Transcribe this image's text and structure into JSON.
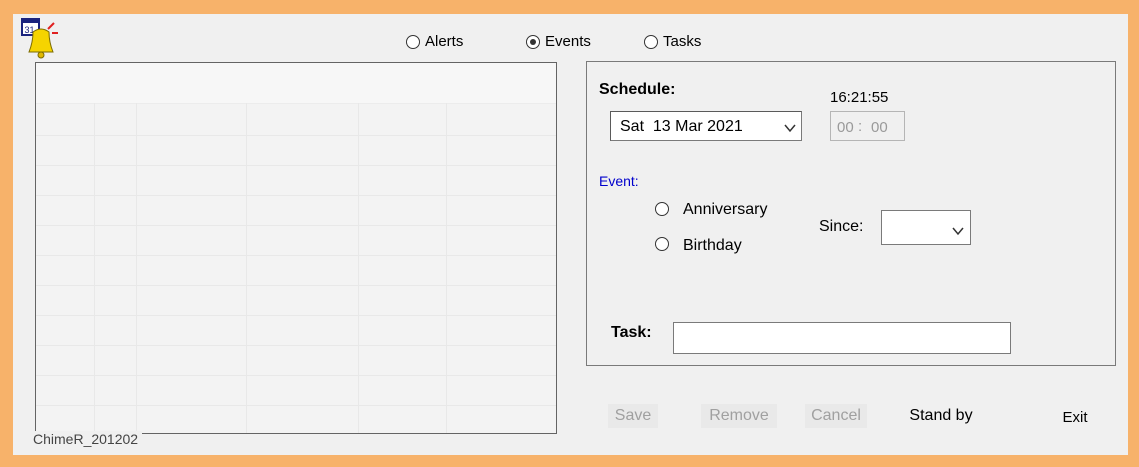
{
  "filter_options": [
    {
      "label": "Alerts",
      "checked": false
    },
    {
      "label": "Events",
      "checked": true
    },
    {
      "label": "Tasks",
      "checked": false
    }
  ],
  "app_icon": "calendar-bell-icon",
  "grid_caption": "ChimeR_201202",
  "schedule": {
    "label": "Schedule:",
    "clock": "16:21:55",
    "date": "Sat  13 Mar 2021",
    "time_hour": "00",
    "time_min": "00"
  },
  "event": {
    "label": "Event:",
    "label_color": "#0000cc",
    "options": [
      {
        "label": "Anniversary",
        "checked": false
      },
      {
        "label": "Birthday",
        "checked": false
      }
    ],
    "since_label": "Since:",
    "since_value": ""
  },
  "task": {
    "label": "Task:",
    "value": ""
  },
  "buttons": {
    "save": "Save",
    "remove": "Remove",
    "cancel": "Cancel",
    "standby": "Stand by",
    "exit": "Exit"
  },
  "colors": {
    "border": "#f7b26a",
    "window_bg": "#f0f0f0"
  }
}
